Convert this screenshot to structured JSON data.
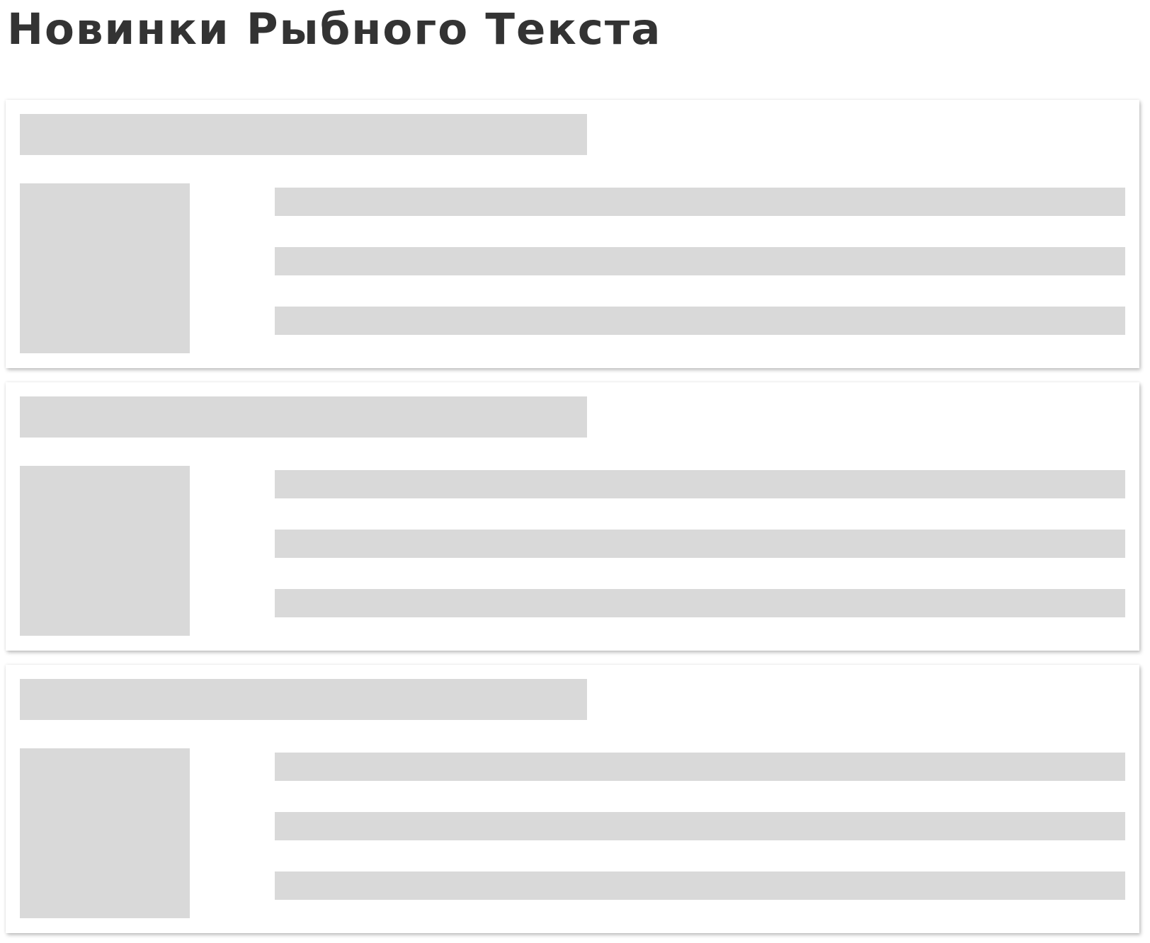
{
  "page": {
    "title": "Новинки Рыбного Текста"
  },
  "skeleton": {
    "placeholder_color": "#d9d9d9",
    "title_color": "#333333",
    "cards": [
      {
        "lines": 3
      },
      {
        "lines": 3
      },
      {
        "lines": 3
      }
    ]
  }
}
